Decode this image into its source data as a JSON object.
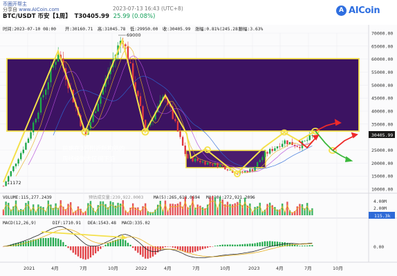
{
  "header": {
    "links": [
      "币圈开帮主",
      "分享自",
      "www.AICoin.com"
    ],
    "prefix": "分享自",
    "site": "www.AICoin.com",
    "link0": "币圈开帮主",
    "datetime": "2023-07-13 16:43 (UTC+8)",
    "symbol": "BTC/USDT 币安【1周】",
    "price": "T30405.99",
    "change": "25.99 (0.08%)",
    "logo_mark": "A",
    "logo_text": "AICoin"
  },
  "info_bar": {
    "time": "时间:2023-07-10 08:00",
    "open": "开:30160.71",
    "high": "高:31045.78",
    "low": "低:29950.00",
    "close": "收:30405.99",
    "rise": "涨幅:0.81%(245.28)",
    "amp": "振幅:3.63%"
  },
  "price_axis": {
    "ticks": [
      "70000.00",
      "65000.00",
      "60000.00",
      "55000.00",
      "50000.00",
      "45000.00",
      "40000.00",
      "35000.00",
      "25000.00",
      "20000.00",
      "15000.00",
      "10000.00"
    ],
    "current": "30405.99"
  },
  "annotations": {
    "high_label": "69000",
    "low_label": "11172",
    "note_line1": "前期在3万附近所构筑的",
    "note_line2": "周线级别大区间下沿"
  },
  "volume": {
    "label": "VOLUME:115,277.2439",
    "forecast": "预估成交量:239,922.0003",
    "ma5": "MA(5):265,618.0694",
    "ma10": "MA(10):272,921.2096",
    "ticks": [
      "4.00M",
      "2.00M"
    ],
    "current": "115.3k"
  },
  "macd": {
    "label": "MACD(12,26,9)",
    "dif": "DIF:1710.91",
    "dea": "DEA:1543.48",
    "macd": "MACD:335.02",
    "ticks": [
      "0.00"
    ]
  },
  "time_axis": [
    "2021",
    "4月",
    "7月",
    "10月",
    "2022",
    "4月",
    "7月",
    "10月",
    "2023",
    "4月",
    "7月",
    "10月"
  ],
  "colors": {
    "up": "#1fa84a",
    "down": "#e0393e",
    "yellow": "#f4e04a",
    "zone": "#3c1362",
    "link": "#3a5aa8",
    "red_arrow": "#ee2a2a",
    "green_arrow": "#3cb83c"
  }
}
